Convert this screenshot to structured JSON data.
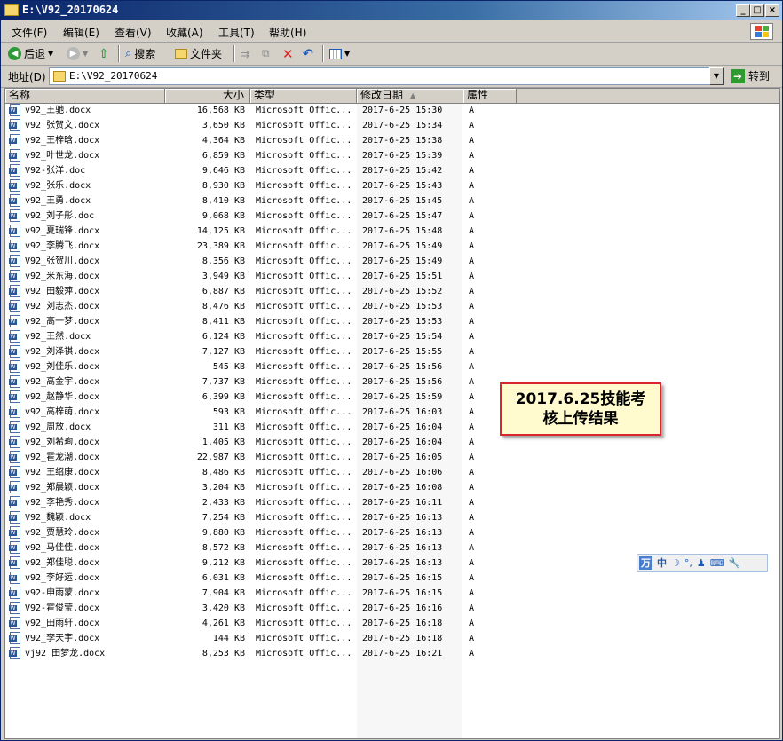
{
  "window": {
    "title": "E:\\V92_20170624",
    "minimize": "_",
    "maximize": "□",
    "close": "×"
  },
  "menu": [
    "文件(F)",
    "编辑(E)",
    "查看(V)",
    "收藏(A)",
    "工具(T)",
    "帮助(H)"
  ],
  "toolbar": {
    "back": "后退",
    "search": "搜索",
    "folders": "文件夹"
  },
  "address": {
    "label": "地址(D)",
    "value": "E:\\V92_20170624",
    "go": "转到"
  },
  "columns": {
    "name": "名称",
    "size": "大小",
    "type": "类型",
    "date": "修改日期",
    "attr": "属性",
    "sort_indicator": "▲"
  },
  "files": [
    {
      "name": "v92_王驰.docx",
      "size": "16,568 KB",
      "type": "Microsoft Offic...",
      "date": "2017-6-25 15:30",
      "attr": "A"
    },
    {
      "name": "v92_张贺文.docx",
      "size": "3,650 KB",
      "type": "Microsoft Offic...",
      "date": "2017-6-25 15:34",
      "attr": "A"
    },
    {
      "name": "v92_王梓晗.docx",
      "size": "4,364 KB",
      "type": "Microsoft Offic...",
      "date": "2017-6-25 15:38",
      "attr": "A"
    },
    {
      "name": "v92_叶世龙.docx",
      "size": "6,859 KB",
      "type": "Microsoft Offic...",
      "date": "2017-6-25 15:39",
      "attr": "A"
    },
    {
      "name": "V92-张洋.doc",
      "size": "9,646 KB",
      "type": "Microsoft Offic...",
      "date": "2017-6-25 15:42",
      "attr": "A"
    },
    {
      "name": "v92_张乐.docx",
      "size": "8,930 KB",
      "type": "Microsoft Offic...",
      "date": "2017-6-25 15:43",
      "attr": "A"
    },
    {
      "name": "v92_王勇.docx",
      "size": "8,410 KB",
      "type": "Microsoft Offic...",
      "date": "2017-6-25 15:45",
      "attr": "A"
    },
    {
      "name": "v92_刘子彤.doc",
      "size": "9,068 KB",
      "type": "Microsoft Offic...",
      "date": "2017-6-25 15:47",
      "attr": "A"
    },
    {
      "name": "v92_夏瑞锋.docx",
      "size": "14,125 KB",
      "type": "Microsoft Offic...",
      "date": "2017-6-25 15:48",
      "attr": "A"
    },
    {
      "name": "v92_李腾飞.docx",
      "size": "23,389 KB",
      "type": "Microsoft Offic...",
      "date": "2017-6-25 15:49",
      "attr": "A"
    },
    {
      "name": "V92_张贺川.docx",
      "size": "8,356 KB",
      "type": "Microsoft Offic...",
      "date": "2017-6-25 15:49",
      "attr": "A"
    },
    {
      "name": "v92_米东海.docx",
      "size": "3,949 KB",
      "type": "Microsoft Offic...",
      "date": "2017-6-25 15:51",
      "attr": "A"
    },
    {
      "name": "v92_田毅萍.docx",
      "size": "6,887 KB",
      "type": "Microsoft Offic...",
      "date": "2017-6-25 15:52",
      "attr": "A"
    },
    {
      "name": "v92_刘志杰.docx",
      "size": "8,476 KB",
      "type": "Microsoft Offic...",
      "date": "2017-6-25 15:53",
      "attr": "A"
    },
    {
      "name": "v92_高一梦.docx",
      "size": "8,411 KB",
      "type": "Microsoft Offic...",
      "date": "2017-6-25 15:53",
      "attr": "A"
    },
    {
      "name": "v92_王然.docx",
      "size": "6,124 KB",
      "type": "Microsoft Offic...",
      "date": "2017-6-25 15:54",
      "attr": "A"
    },
    {
      "name": "v92_刘泽祺.docx",
      "size": "7,127 KB",
      "type": "Microsoft Offic...",
      "date": "2017-6-25 15:55",
      "attr": "A"
    },
    {
      "name": "v92_刘佳乐.docx",
      "size": "545 KB",
      "type": "Microsoft Offic...",
      "date": "2017-6-25 15:56",
      "attr": "A"
    },
    {
      "name": "v92_高金宇.docx",
      "size": "7,737 KB",
      "type": "Microsoft Offic...",
      "date": "2017-6-25 15:56",
      "attr": "A"
    },
    {
      "name": "v92_赵静华.docx",
      "size": "6,399 KB",
      "type": "Microsoft Offic...",
      "date": "2017-6-25 15:59",
      "attr": "A"
    },
    {
      "name": "v92_高梓萌.docx",
      "size": "593 KB",
      "type": "Microsoft Offic...",
      "date": "2017-6-25 16:03",
      "attr": "A"
    },
    {
      "name": "v92_周放.docx",
      "size": "311 KB",
      "type": "Microsoft Offic...",
      "date": "2017-6-25 16:04",
      "attr": "A"
    },
    {
      "name": "v92_刘希珣.docx",
      "size": "1,405 KB",
      "type": "Microsoft Offic...",
      "date": "2017-6-25 16:04",
      "attr": "A"
    },
    {
      "name": "v92_霍龙潮.docx",
      "size": "22,987 KB",
      "type": "Microsoft Offic...",
      "date": "2017-6-25 16:05",
      "attr": "A"
    },
    {
      "name": "v92_王绍康.docx",
      "size": "8,486 KB",
      "type": "Microsoft Offic...",
      "date": "2017-6-25 16:06",
      "attr": "A"
    },
    {
      "name": "v92_郑晨颖.docx",
      "size": "3,204 KB",
      "type": "Microsoft Offic...",
      "date": "2017-6-25 16:08",
      "attr": "A"
    },
    {
      "name": "v92_李艳秀.docx",
      "size": "2,433 KB",
      "type": "Microsoft Offic...",
      "date": "2017-6-25 16:11",
      "attr": "A"
    },
    {
      "name": "V92_魏颖.docx",
      "size": "7,254 KB",
      "type": "Microsoft Offic...",
      "date": "2017-6-25 16:13",
      "attr": "A"
    },
    {
      "name": "v92_贾慧玲.docx",
      "size": "9,880 KB",
      "type": "Microsoft Offic...",
      "date": "2017-6-25 16:13",
      "attr": "A"
    },
    {
      "name": "v92_马佳佳.docx",
      "size": "8,572 KB",
      "type": "Microsoft Offic...",
      "date": "2017-6-25 16:13",
      "attr": "A"
    },
    {
      "name": "v92_郑佳聪.docx",
      "size": "9,212 KB",
      "type": "Microsoft Offic...",
      "date": "2017-6-25 16:13",
      "attr": "A"
    },
    {
      "name": "v92_李好运.docx",
      "size": "6,031 KB",
      "type": "Microsoft Offic...",
      "date": "2017-6-25 16:15",
      "attr": "A"
    },
    {
      "name": "v92-申雨蒙.docx",
      "size": "7,904 KB",
      "type": "Microsoft Offic...",
      "date": "2017-6-25 16:15",
      "attr": "A"
    },
    {
      "name": "V92-霍俊莹.docx",
      "size": "3,420 KB",
      "type": "Microsoft Offic...",
      "date": "2017-6-25 16:16",
      "attr": "A"
    },
    {
      "name": "v92_田雨轩.docx",
      "size": "4,261 KB",
      "type": "Microsoft Offic...",
      "date": "2017-6-25 16:18",
      "attr": "A"
    },
    {
      "name": "V92_李天宇.docx",
      "size": "144 KB",
      "type": "Microsoft Offic...",
      "date": "2017-6-25 16:18",
      "attr": "A"
    },
    {
      "name": "vj92_田梦龙.docx",
      "size": "8,253 KB",
      "type": "Microsoft Offic...",
      "date": "2017-6-25 16:21",
      "attr": "A"
    }
  ],
  "annotation": {
    "line1": "2017.6.25技能考",
    "line2": "核上传结果"
  },
  "ime": {
    "logo": "万",
    "mode": "中",
    "moon": "☽",
    "punct": "°,",
    "person": "♟",
    "keyboard": "⌨",
    "tools": "🔧"
  },
  "colors": {
    "title_start": "#0a246a",
    "title_end": "#a6caf0",
    "annotation_border": "#d8252e",
    "annotation_bg": "#fffbcf"
  }
}
